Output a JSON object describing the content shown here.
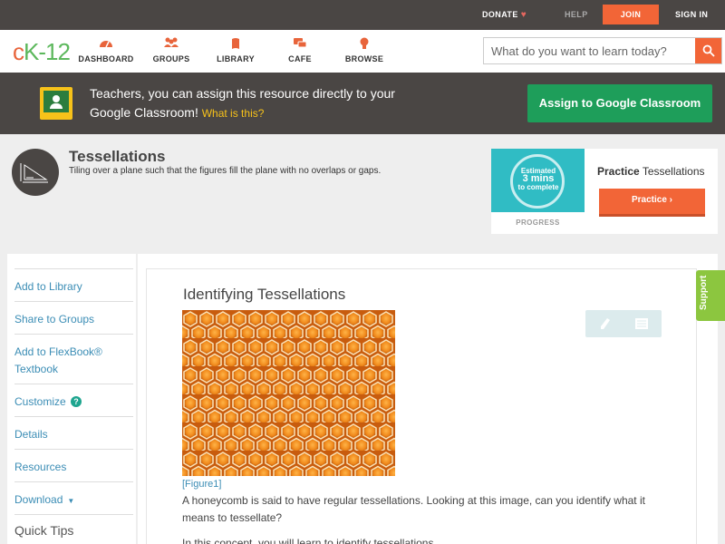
{
  "topbar": {
    "donate": "DONATE",
    "help": "HELP",
    "join": "JOIN",
    "signin": "SIGN IN"
  },
  "nav": {
    "logo": {
      "c": "c",
      "k": "K",
      "num": "-12"
    },
    "items": [
      {
        "label": "DASHBOARD",
        "icon": "dashboard-icon"
      },
      {
        "label": "GROUPS",
        "icon": "groups-icon"
      },
      {
        "label": "LIBRARY",
        "icon": "library-icon"
      },
      {
        "label": "CAFE",
        "icon": "cafe-icon"
      },
      {
        "label": "BROWSE",
        "icon": "browse-icon"
      }
    ],
    "search_placeholder": "What do you want to learn today?"
  },
  "classroom": {
    "text": "Teachers, you can assign this resource directly to your Google Classroom!",
    "what": "What is this?",
    "button": "Assign to Google Classroom"
  },
  "concept": {
    "title": "Tessellations",
    "description": "Tiling over a plane such that the figures fill the plane with no overlaps or gaps."
  },
  "practice": {
    "estimated": "Estimated",
    "minutes": "3 mins",
    "to_complete": "to complete",
    "progress_label": "PROGRESS",
    "title_bold": "Practice",
    "title_rest": "Tessellations",
    "button": "Practice"
  },
  "sidebar": {
    "items": [
      "Add to Library",
      "Share to Groups",
      "Add to FlexBook® Textbook",
      "Customize",
      "Details",
      "Resources",
      "Download"
    ],
    "quick_tips": "Quick Tips"
  },
  "article": {
    "title": "Identifying Tessellations",
    "figure_caption": "[Figure1]",
    "para1": "A honeycomb is said to have regular tessellations. Looking at this image, can you identify what it means to tessellate?",
    "para2": "In this concept, you will learn to identify tessellations."
  },
  "support": "Support",
  "colors": {
    "accent_orange": "#f26537",
    "dark_bar": "#4a4644",
    "link_blue": "#3b8db5",
    "google_green": "#1e9e5a",
    "support_green": "#8cc63f"
  }
}
